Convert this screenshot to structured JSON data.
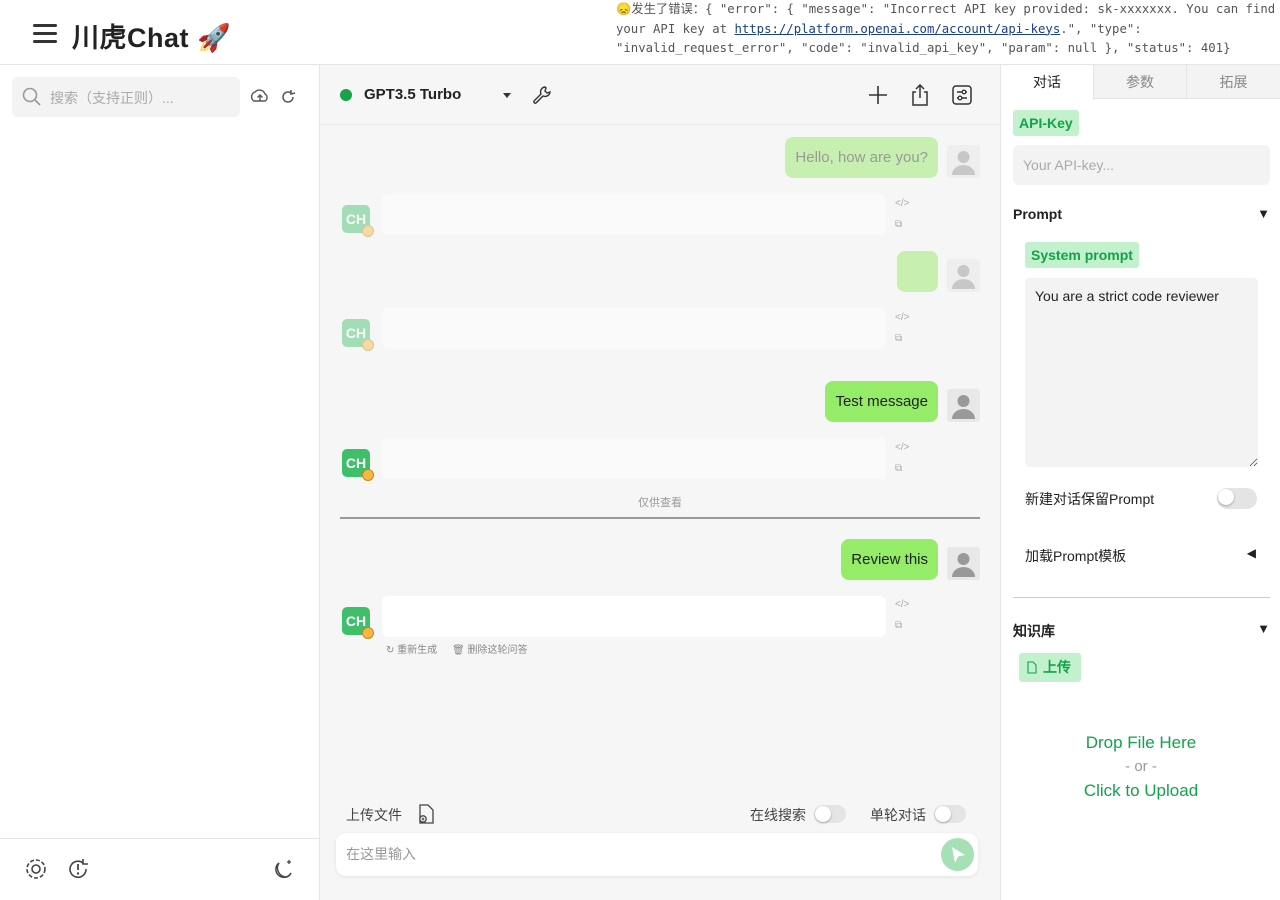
{
  "app": {
    "title": "川虎Chat 🚀"
  },
  "error": {
    "prefix": "😞发生了错误：{ \"error\": { \"message\": \"Incorrect API key provided: sk-xxxxxxx. You can find your API key at ",
    "link": "https://platform.openai.com/account/api-keys",
    "suffix": ".\", \"type\": \"invalid_request_error\", \"code\": \"invalid_api_key\", \"param\": null }, \"status\": 401}"
  },
  "sidebar": {
    "search_placeholder": "搜索（支持正则）..."
  },
  "chat": {
    "model": "GPT3.5 Turbo",
    "messages": [
      {
        "role": "user",
        "text": "Hello, how are you?",
        "faded": true
      },
      {
        "role": "bot",
        "text": ""
      },
      {
        "role": "user",
        "text": "",
        "faded": true
      },
      {
        "role": "bot",
        "text": ""
      },
      {
        "role": "user",
        "text": "Test message"
      },
      {
        "role": "bot",
        "text": ""
      },
      {
        "role": "user",
        "text": "Review this"
      },
      {
        "role": "bot",
        "text": ""
      }
    ],
    "divider_label": "仅供查看",
    "regenerate_label": "重新生成",
    "delete_round_label": "删除这轮问答",
    "upload_label": "上传文件",
    "online_search_label": "在线搜索",
    "single_turn_label": "单轮对话",
    "input_placeholder": "在这里输入"
  },
  "right": {
    "tabs": [
      "对话",
      "参数",
      "拓展"
    ],
    "active_tab": 0,
    "api_key_tag": "API-Key",
    "api_key_placeholder": "Your API-key...",
    "prompt_title": "Prompt",
    "system_prompt_tag": "System prompt",
    "system_prompt_value": "You are a strict code reviewer",
    "keep_prompt_label": "新建对话保留Prompt",
    "load_template_label": "加载Prompt模板",
    "knowledge_title": "知识库",
    "upload_btn": "上传",
    "drop_line1": "Drop File Here",
    "drop_or": "- or -",
    "drop_line2": "Click to Upload"
  },
  "colors": {
    "accent": "#12a34a",
    "user_bubble": "#95ec69",
    "status": "#16a34a"
  }
}
